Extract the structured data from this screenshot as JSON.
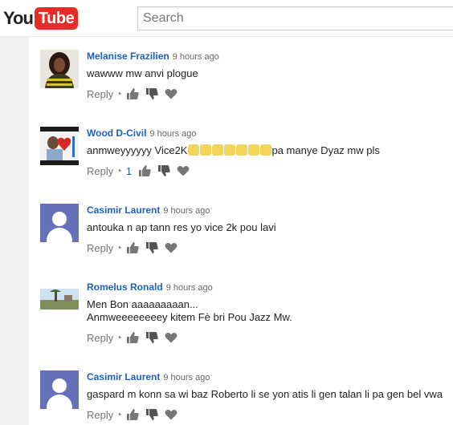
{
  "header": {
    "logo_you": "You",
    "logo_tube": "Tube",
    "search_placeholder": "Search"
  },
  "comments": [
    {
      "author": "Melanise Frazilien",
      "time": "9 hours ago",
      "text": "wawww mw anvi plogue",
      "reply_label": "Reply",
      "avatar": "photo-woman"
    },
    {
      "author": "Wood D-Civil",
      "time": "9 hours ago",
      "text_before": "anmweyyyyyy Vice2K",
      "emoji_count": 7,
      "text_after": "pa manye Dyaz mw pls",
      "reply_label": "Reply",
      "like_count": "1",
      "avatar": "photo-heart"
    },
    {
      "author": "Casimir Laurent",
      "time": "9 hours ago",
      "text": "antouka n ap tann res yo vice 2k pou lavi",
      "reply_label": "Reply",
      "avatar": "default"
    },
    {
      "author": "Romelus Ronald",
      "time": "9 hours ago",
      "text": "Men Bon aaaaaaaaan...\nAnmweeeeeeeey kitem Fè bri Pou Jazz Mw.",
      "reply_label": "Reply",
      "avatar": "photo-landscape"
    },
    {
      "author": "Casimir Laurent",
      "time": "9 hours ago",
      "text": "gaspard m konn sa wi baz Roberto li se yon atis li gen talan li pa gen bel vwa",
      "reply_label": "Reply",
      "avatar": "default"
    }
  ],
  "colors": {
    "author": "#1c62b9",
    "logo_red": "#e52d27",
    "avatar_default": "#6670b8"
  }
}
